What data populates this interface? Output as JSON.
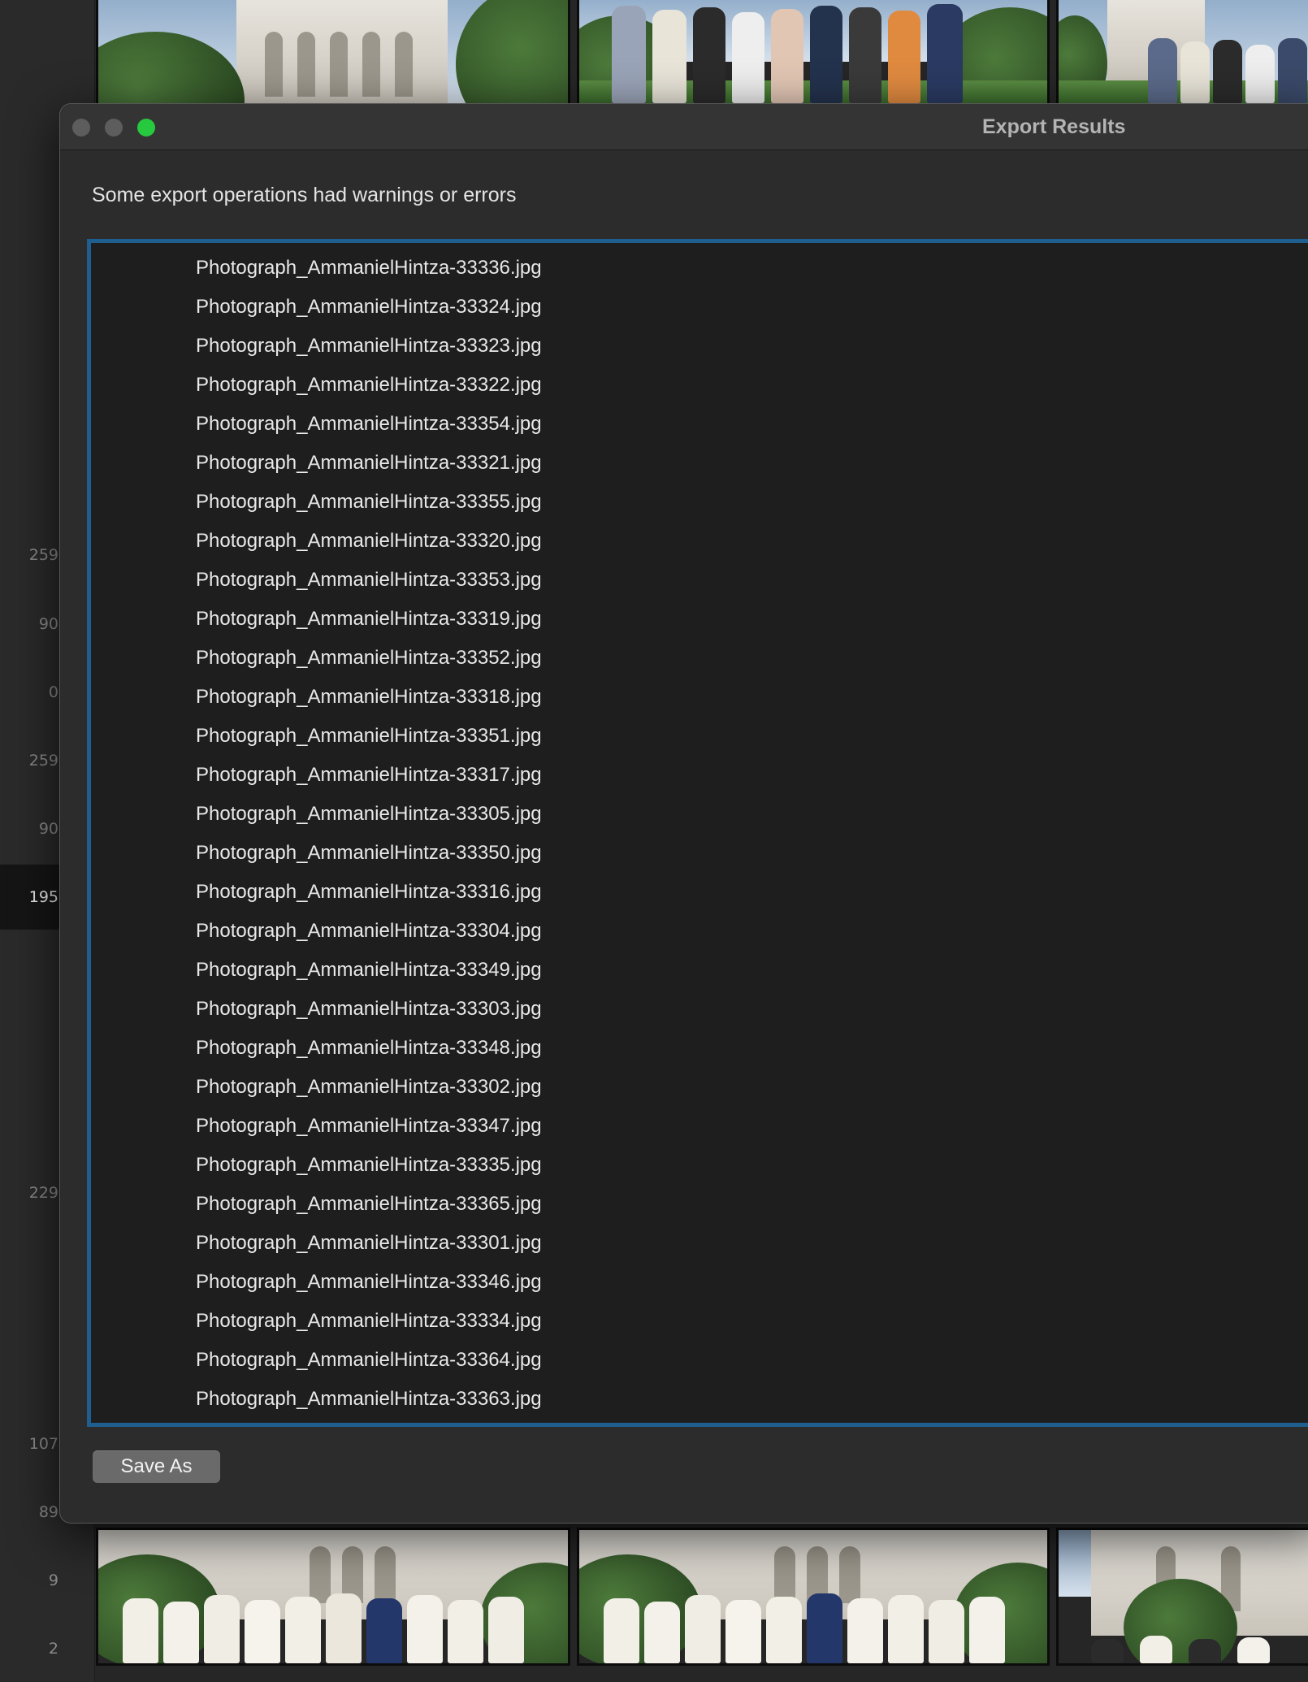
{
  "background": {
    "sidebar_numbers": [
      "259",
      "90",
      "0",
      "259",
      "90",
      "195",
      "229",
      "107",
      "89",
      "9",
      "2"
    ],
    "active_number": "195"
  },
  "dialog": {
    "title": "Export Results",
    "message": "Some export operations had warnings or errors",
    "files": [
      "Photograph_AmmanielHintza-33336.jpg",
      "Photograph_AmmanielHintza-33324.jpg",
      "Photograph_AmmanielHintza-33323.jpg",
      "Photograph_AmmanielHintza-33322.jpg",
      "Photograph_AmmanielHintza-33354.jpg",
      "Photograph_AmmanielHintza-33321.jpg",
      "Photograph_AmmanielHintza-33355.jpg",
      "Photograph_AmmanielHintza-33320.jpg",
      "Photograph_AmmanielHintza-33353.jpg",
      "Photograph_AmmanielHintza-33319.jpg",
      "Photograph_AmmanielHintza-33352.jpg",
      "Photograph_AmmanielHintza-33318.jpg",
      "Photograph_AmmanielHintza-33351.jpg",
      "Photograph_AmmanielHintza-33317.jpg",
      "Photograph_AmmanielHintza-33305.jpg",
      "Photograph_AmmanielHintza-33350.jpg",
      "Photograph_AmmanielHintza-33316.jpg",
      "Photograph_AmmanielHintza-33304.jpg",
      "Photograph_AmmanielHintza-33349.jpg",
      "Photograph_AmmanielHintza-33303.jpg",
      "Photograph_AmmanielHintza-33348.jpg",
      "Photograph_AmmanielHintza-33302.jpg",
      "Photograph_AmmanielHintza-33347.jpg",
      "Photograph_AmmanielHintza-33335.jpg",
      "Photograph_AmmanielHintza-33365.jpg",
      "Photograph_AmmanielHintza-33301.jpg",
      "Photograph_AmmanielHintza-33346.jpg",
      "Photograph_AmmanielHintza-33334.jpg",
      "Photograph_AmmanielHintza-33364.jpg",
      "Photograph_AmmanielHintza-33363.jpg"
    ],
    "save_label": "Save As"
  },
  "colors": {
    "focus_ring": "#1f5f8f",
    "maximize_button": "#27c93f",
    "dialog_background": "#2c2c2c"
  }
}
